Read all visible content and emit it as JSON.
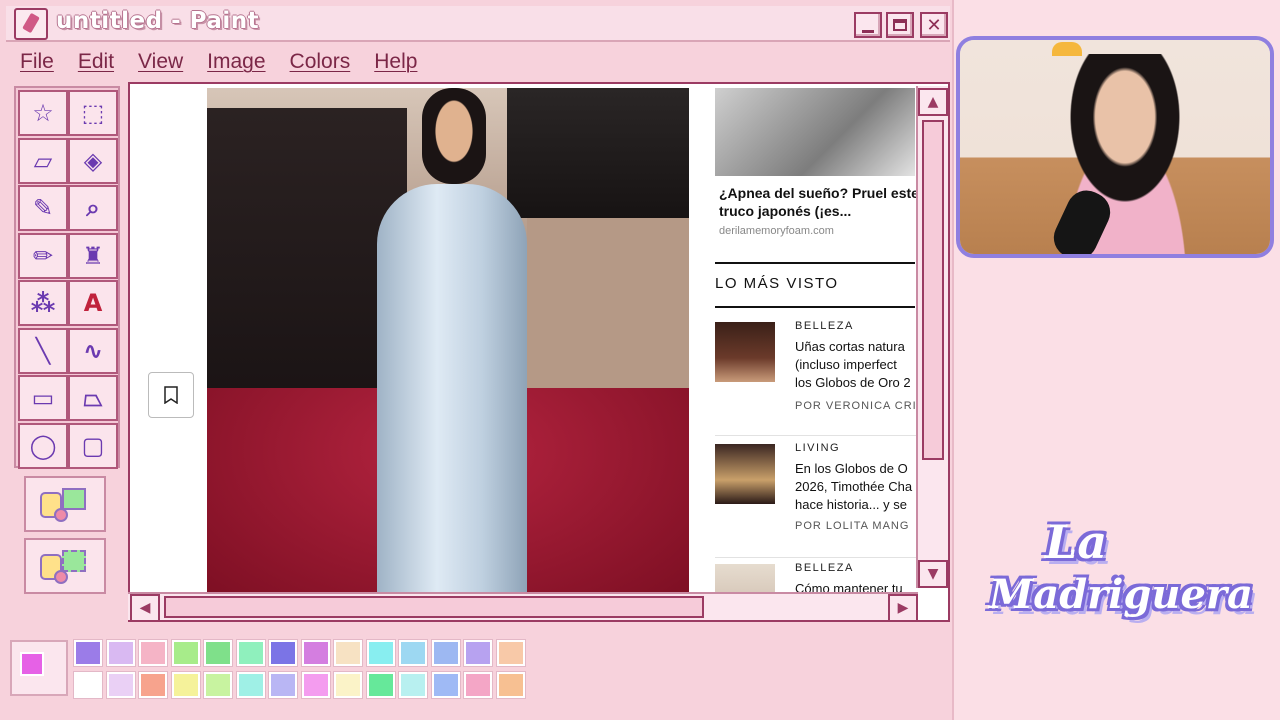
{
  "window": {
    "title": "untitled - Paint",
    "controls": [
      "minimize",
      "maximize",
      "close"
    ],
    "close_glyph": "✕"
  },
  "menu": [
    "File",
    "Edit",
    "View",
    "Image",
    "Colors",
    "Help"
  ],
  "tools": [
    {
      "name": "free-select-tool",
      "icon": "star-select-icon",
      "glyph": "☆"
    },
    {
      "name": "rect-select-tool",
      "icon": "rect-select-icon",
      "glyph": "⬚"
    },
    {
      "name": "eraser-tool",
      "icon": "eraser-icon",
      "glyph": "▱"
    },
    {
      "name": "fill-tool",
      "icon": "paint-bucket-icon",
      "glyph": "◈"
    },
    {
      "name": "color-picker-tool",
      "icon": "eyedropper-icon",
      "glyph": "✎"
    },
    {
      "name": "magnifier-tool",
      "icon": "magnifier-icon",
      "glyph": "⌕"
    },
    {
      "name": "pencil-tool",
      "icon": "pencil-icon",
      "glyph": "✏"
    },
    {
      "name": "brush-tool",
      "icon": "brush-icon",
      "glyph": "♜"
    },
    {
      "name": "airbrush-tool",
      "icon": "airbrush-icon",
      "glyph": "⁂"
    },
    {
      "name": "text-tool",
      "icon": "text-icon",
      "glyph": "A"
    },
    {
      "name": "line-tool",
      "icon": "line-icon",
      "glyph": "╲"
    },
    {
      "name": "curve-tool",
      "icon": "curve-icon",
      "glyph": "∿"
    },
    {
      "name": "rectangle-tool",
      "icon": "rectangle-icon",
      "glyph": "▭"
    },
    {
      "name": "polygon-tool",
      "icon": "polygon-icon",
      "glyph": "⏢"
    },
    {
      "name": "ellipse-tool",
      "icon": "ellipse-icon",
      "glyph": "◯"
    },
    {
      "name": "rounded-rect-tool",
      "icon": "rounded-rect-icon",
      "glyph": "▢"
    }
  ],
  "canvas_page": {
    "ad": {
      "title": "¿Apnea del sueño? Pruel este truco japonés (¡es...",
      "source": "derilamemoryfoam.com"
    },
    "section_title": "LO MÁS VISTO",
    "articles": [
      {
        "category": "BELLEZA",
        "headline": "Uñas cortas natura\n(incluso imperfect\nlos Globos de Oro 2",
        "byline": "POR VERONICA CRIS",
        "thumb_color": "#6b3a2a"
      },
      {
        "category": "LIVING",
        "headline": "En los Globos de O\n2026, Timothée Cha\nhace historia... y se",
        "byline": "POR LOLITA MANG",
        "thumb_color": "#3a2622"
      },
      {
        "category": "BELLEZA",
        "headline": "Cómo mantener tu",
        "byline": "",
        "thumb_color": "#cbb8a8"
      }
    ]
  },
  "palette": {
    "foreground": "#e661e6",
    "background": "#fbe6ee",
    "row1": [
      "#9b7ce8",
      "#d9b9f2",
      "#f5b4c6",
      "#a7ec8a",
      "#7fe08a",
      "#8ff0bd",
      "#7b74e6",
      "#d47ee0",
      "#f7e2c3",
      "#88eef0",
      "#9dd8f2",
      "#9db8f2",
      "#b7a2f0",
      "#f8c9a8"
    ],
    "row2": [
      "#ffffff",
      "#ead0f5",
      "#f7a38d",
      "#f5f29a",
      "#c8f3a0",
      "#9ff0e6",
      "#b9b6f4",
      "#f49cef",
      "#fbf3c8",
      "#66e89a",
      "#b8f0f0",
      "#9fbaf5",
      "#f4a6c6",
      "#f7c092"
    ]
  },
  "logo": {
    "line1": "La",
    "line2": "Madriguera"
  }
}
